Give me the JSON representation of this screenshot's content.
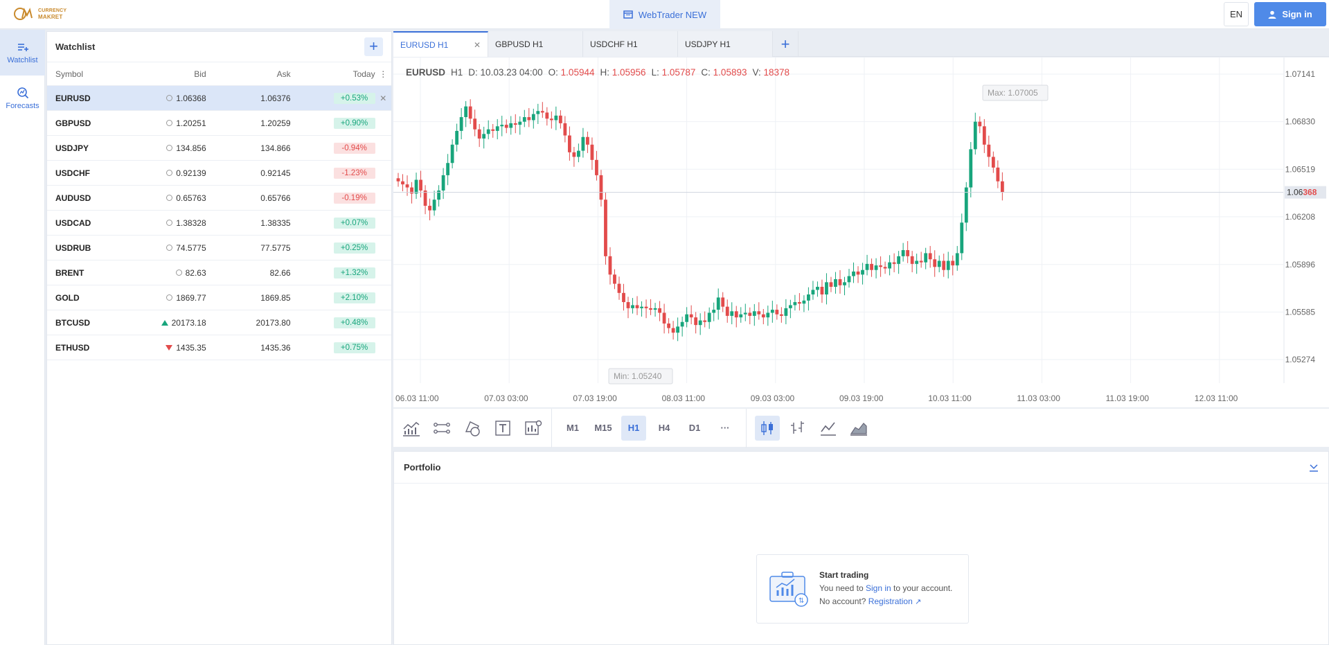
{
  "brand": {
    "logo_line1": "CURRENCY",
    "logo_line2": "MAKRET"
  },
  "header": {
    "webtrader_label": "WebTrader NEW",
    "lang": "EN",
    "signin_label": "Sign in"
  },
  "sidenav": [
    {
      "label": "Watchlist",
      "icon": "watchlist-icon",
      "active": true
    },
    {
      "label": "Forecasts",
      "icon": "forecasts-icon",
      "active": false
    }
  ],
  "watchlist": {
    "title": "Watchlist",
    "columns": {
      "symbol": "Symbol",
      "bid": "Bid",
      "ask": "Ask",
      "today": "Today"
    },
    "rows": [
      {
        "symbol": "EURUSD",
        "bid": "1.06368",
        "ask": "1.06376",
        "today": "+0.53%",
        "dir": "up",
        "icon": "clock"
      },
      {
        "symbol": "GBPUSD",
        "bid": "1.20251",
        "ask": "1.20259",
        "today": "+0.90%",
        "dir": "up",
        "icon": "clock"
      },
      {
        "symbol": "USDJPY",
        "bid": "134.856",
        "ask": "134.866",
        "today": "-0.94%",
        "dir": "down",
        "icon": "clock"
      },
      {
        "symbol": "USDCHF",
        "bid": "0.92139",
        "ask": "0.92145",
        "today": "-1.23%",
        "dir": "down",
        "icon": "clock"
      },
      {
        "symbol": "AUDUSD",
        "bid": "0.65763",
        "ask": "0.65766",
        "today": "-0.19%",
        "dir": "down",
        "icon": "clock"
      },
      {
        "symbol": "USDCAD",
        "bid": "1.38328",
        "ask": "1.38335",
        "today": "+0.07%",
        "dir": "up",
        "icon": "clock"
      },
      {
        "symbol": "USDRUB",
        "bid": "74.5775",
        "ask": "77.5775",
        "today": "+0.25%",
        "dir": "up",
        "icon": "clock"
      },
      {
        "symbol": "BRENT",
        "bid": "82.63",
        "ask": "82.66",
        "today": "+1.32%",
        "dir": "up",
        "icon": "clock"
      },
      {
        "symbol": "GOLD",
        "bid": "1869.77",
        "ask": "1869.85",
        "today": "+2.10%",
        "dir": "up",
        "icon": "clock"
      },
      {
        "symbol": "BTCUSD",
        "bid": "20173.18",
        "ask": "20173.80",
        "today": "+0.48%",
        "dir": "up",
        "icon": "arrow-up"
      },
      {
        "symbol": "ETHUSD",
        "bid": "1435.35",
        "ask": "1435.36",
        "today": "+0.75%",
        "dir": "up",
        "icon": "arrow-down"
      }
    ]
  },
  "tabs": [
    {
      "label": "EURUSD H1",
      "active": true
    },
    {
      "label": "GBPUSD H1",
      "active": false
    },
    {
      "label": "USDCHF H1",
      "active": false
    },
    {
      "label": "USDJPY H1",
      "active": false
    }
  ],
  "chart_header": {
    "symbol": "EURUSD",
    "tf": "H1",
    "d_label": "D:",
    "d_value": "10.03.23 04:00",
    "o_label": "O:",
    "o_value": "1.05944",
    "h_label": "H:",
    "h_value": "1.05956",
    "l_label": "L:",
    "l_value": "1.05787",
    "c_label": "C:",
    "c_value": "1.05893",
    "v_label": "V:",
    "v_value": "18378"
  },
  "chart_data": {
    "type": "candlestick",
    "y_ticks": [
      "1.07141",
      "1.06830",
      "1.06519",
      "1.06208",
      "1.05896",
      "1.05585",
      "1.05274"
    ],
    "current_price_main": "1.06",
    "current_price_emph": "368",
    "current_price": 1.06368,
    "max_label": "Max: 1.07005",
    "min_label": "Min: 1.05240",
    "x_ticks": [
      "06.03 11:00",
      "07.03 03:00",
      "07.03 19:00",
      "08.03 11:00",
      "09.03 03:00",
      "09.03 19:00",
      "10.03 11:00",
      "11.03 03:00",
      "11.03 19:00",
      "12.03 11:00"
    ],
    "ylim": [
      1.0512,
      1.0725
    ],
    "closes": [
      1.0644,
      1.0642,
      1.064,
      1.0636,
      1.0645,
      1.0638,
      1.0628,
      1.0625,
      1.0632,
      1.0638,
      1.0648,
      1.0656,
      1.0668,
      1.0677,
      1.0686,
      1.0693,
      1.0685,
      1.0678,
      1.0672,
      1.0675,
      1.0678,
      1.0677,
      1.068,
      1.0681,
      1.0679,
      1.0682,
      1.0681,
      1.0683,
      1.0686,
      1.0684,
      1.0688,
      1.069,
      1.0689,
      1.0685,
      1.0684,
      1.0687,
      1.0682,
      1.0674,
      1.0663,
      1.066,
      1.0664,
      1.0673,
      1.0668,
      1.0658,
      1.0648,
      1.0632,
      1.0595,
      1.0583,
      1.0577,
      1.0571,
      1.0565,
      1.0561,
      1.0563,
      1.0561,
      1.0562,
      1.0561,
      1.056,
      1.0561,
      1.0558,
      1.0551,
      1.0548,
      1.0545,
      1.0549,
      1.0552,
      1.0557,
      1.0555,
      1.055,
      1.0553,
      1.0552,
      1.0558,
      1.056,
      1.0568,
      1.0562,
      1.0556,
      1.0559,
      1.0555,
      1.0557,
      1.0558,
      1.0556,
      1.0559,
      1.0557,
      1.0555,
      1.0558,
      1.056,
      1.0557,
      1.0556,
      1.0561,
      1.0563,
      1.0565,
      1.0564,
      1.0566,
      1.057,
      1.0573,
      1.0575,
      1.057,
      1.0578,
      1.0575,
      1.058,
      1.0576,
      1.0578,
      1.0582,
      1.0585,
      1.0583,
      1.0586,
      1.059,
      1.0586,
      1.0589,
      1.0588,
      1.0587,
      1.0591,
      1.059,
      1.0595,
      1.0599,
      1.0595,
      1.059,
      1.0592,
      1.0591,
      1.0597,
      1.0593,
      1.0588,
      1.0592,
      1.0586,
      1.0592,
      1.0589,
      1.0597,
      1.0617,
      1.064,
      1.0665,
      1.0683,
      1.068,
      1.0668,
      1.066,
      1.0653,
      1.0644,
      1.0637
    ],
    "series_colors": {
      "up": "#18a57c",
      "down": "#e24b4b"
    }
  },
  "toolbar": {
    "draw_tools": [
      "indicators-icon",
      "line-tool-icon",
      "shapes-icon",
      "text-tool-icon",
      "chart-settings-icon"
    ],
    "timeframes": [
      "M1",
      "M15",
      "H1",
      "H4",
      "D1",
      "···"
    ],
    "active_tf": "H1",
    "chart_types": [
      "candles-icon",
      "bars-icon",
      "line-chart-icon",
      "area-chart-icon"
    ]
  },
  "portfolio": {
    "title": "Portfolio",
    "card_title": "Start trading",
    "line1_pre": "You need to ",
    "line1_link": "Sign in",
    "line1_post": " to your account.",
    "line2_pre": "No account? ",
    "line2_link": "Registration"
  },
  "colors": {
    "accent": "#3a6fd8",
    "up": "#18a57c",
    "down": "#e24b4b"
  }
}
